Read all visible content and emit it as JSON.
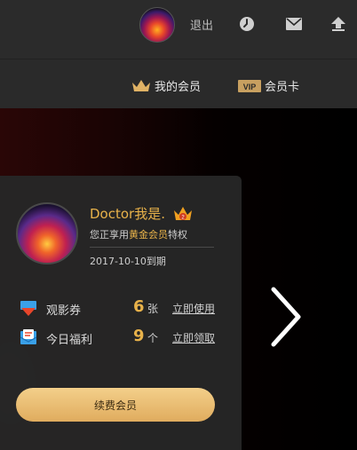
{
  "header": {
    "logout_label": "退出",
    "icons": [
      "clock-icon",
      "mail-icon",
      "upload-icon"
    ]
  },
  "nav": {
    "my_membership": "我的会员",
    "member_card": "会员卡",
    "vip_badge": "VIP"
  },
  "profile": {
    "name": "Doctor我是.",
    "crown_level": "2",
    "privilege_prefix": "您正享用",
    "privilege_tier": "黄金会员",
    "privilege_suffix": "特权",
    "expire_text": "2017-10-10到期"
  },
  "benefits": [
    {
      "label": "观影券",
      "count": "6",
      "unit": "张",
      "action": "立即使用"
    },
    {
      "label": "今日福利",
      "count": "9",
      "unit": "个",
      "action": "立即领取"
    }
  ],
  "renew_button": "续费会员",
  "colors": {
    "gold": "#e8b24a",
    "topbar": "#2b2b2b",
    "card": "#262626"
  }
}
